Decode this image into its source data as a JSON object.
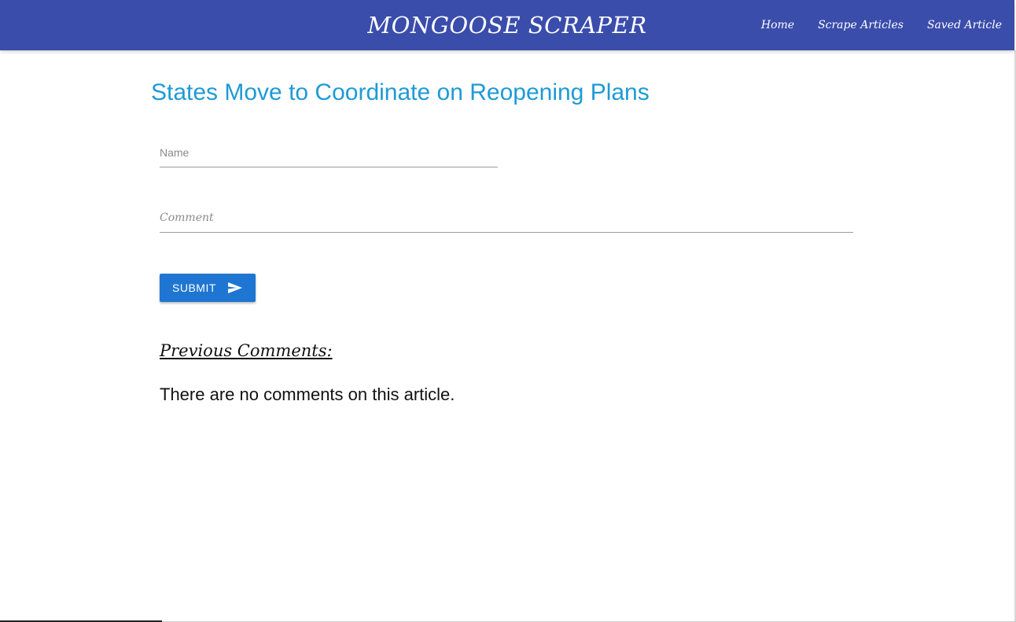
{
  "navbar": {
    "brand": "MONGOOSE SCRAPER",
    "links": [
      "Home",
      "Scrape Articles",
      "Saved Article"
    ]
  },
  "article": {
    "title": "States Move to Coordinate on Reopening Plans"
  },
  "form": {
    "name_placeholder": "Name",
    "comment_placeholder": "Comment",
    "submit_label": "SUBMIT",
    "submit_icon": "send-icon"
  },
  "comments": {
    "heading": "Previous Comments:",
    "empty_message": "There are no comments on this article."
  },
  "colors": {
    "navbar": "#3a4dab",
    "title": "#1e9ad6",
    "button": "#1e76d2"
  }
}
